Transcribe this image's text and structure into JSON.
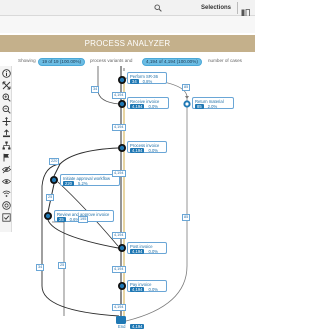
{
  "header": {
    "selections_label": "Selections",
    "truncated_label": "In"
  },
  "title": "PROCESS ANALYZER",
  "summary": {
    "showing": "Showing",
    "variants_value": "19 of 19 (100.00%)",
    "variants_text": "process variants and",
    "cases_value": "4,194 of 4,194 (100.00%)",
    "cases_text": "number of cases"
  },
  "toolbar": {
    "icons": [
      "info-icon",
      "expand-icon",
      "zoom-in-icon",
      "zoom-out-icon",
      "pan-icon",
      "upload-icon",
      "tree-icon",
      "hide-icon",
      "visibility-icon",
      "eye-slash-icon",
      "wifi-icon",
      "radar-icon",
      "checkbox-icon"
    ]
  },
  "nodes": [
    {
      "label": "Perform SR-36",
      "count": "34",
      "pct": "0.8%"
    },
    {
      "label": "Receive invoice",
      "count": "4,194",
      "pct": "0.0%"
    },
    {
      "label": "Return material",
      "count": "85",
      "pct": "2.0%"
    },
    {
      "label": "Process invoice",
      "count": "4,194",
      "pct": "0.0%"
    },
    {
      "label": "Initiate approval workflow",
      "count": "220",
      "pct": "5.2%"
    },
    {
      "label": "Review and approve invoice",
      "count": "25",
      "pct": "0.6%"
    },
    {
      "label": "Post invoice",
      "count": "4,194",
      "pct": "0.0%"
    },
    {
      "label": "Pay invoice",
      "count": "4,194",
      "pct": "0.0%"
    },
    {
      "label": "End",
      "count": "4,194",
      "pct": ""
    }
  ],
  "edge_labels": [
    "4,194",
    "34",
    "85",
    "4,194",
    "220",
    "25",
    "25",
    "34",
    "85",
    "195",
    "4,194",
    "4,194",
    "4,194",
    "4,194"
  ],
  "colors": {
    "title_bar": "#c4b08b",
    "accent_blue": "#1f78b4",
    "pill": "#6cbde4",
    "edge": "#2c2c2c",
    "highlight": "#d9b860"
  }
}
